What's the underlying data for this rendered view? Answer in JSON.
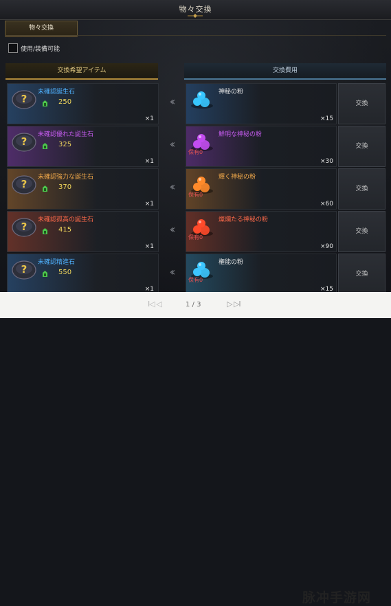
{
  "window": {
    "title": "物々交換"
  },
  "tab": {
    "label": "物々交換"
  },
  "filter": {
    "label": "使用/装備可能"
  },
  "headers": {
    "left": "交換希望アイテム",
    "right": "交換費用"
  },
  "colors": {
    "rarity_blue": "#4fb2ff",
    "rarity_purple": "#c65cf0",
    "rarity_orange": "#f0a84a",
    "rarity_red": "#ff6a4a",
    "value_yellow": "#f2d85c",
    "owned_red": "#e05252"
  },
  "rows": [
    {
      "item_name": "未確認誕生石",
      "item_color": "#4fb2ff",
      "item_value": "250",
      "item_qty": "×1",
      "mat_name": "神秘の粉",
      "mat_color": "#e6e6e6",
      "mat_kind": "blue",
      "owned": "",
      "mat_qty": "×15",
      "button": "交換"
    },
    {
      "item_name": "未確認優れた誕生石",
      "item_color": "#c65cf0",
      "item_value": "325",
      "item_qty": "×1",
      "mat_name": "鮮明な神秘の粉",
      "mat_color": "#c65cf0",
      "mat_kind": "purple",
      "owned": "保有0",
      "mat_qty": "×30",
      "button": "交換"
    },
    {
      "item_name": "未確認強力な誕生石",
      "item_color": "#f0a84a",
      "item_value": "370",
      "item_qty": "×1",
      "mat_name": "輝く神秘の粉",
      "mat_color": "#f0a84a",
      "mat_kind": "orange",
      "owned": "保有0",
      "mat_qty": "×60",
      "button": "交換"
    },
    {
      "item_name": "未確認孤高の誕生石",
      "item_color": "#ff6a4a",
      "item_value": "415",
      "item_qty": "×1",
      "mat_name": "燦爛たる神秘の粉",
      "mat_color": "#ff6a4a",
      "mat_kind": "red",
      "owned": "保有0",
      "mat_qty": "×90",
      "button": "交換"
    },
    {
      "item_name": "未確認精進石",
      "item_color": "#4fb2ff",
      "item_value": "550",
      "item_qty": "×1",
      "mat_name": "権能の粉",
      "mat_color": "#e6e6e6",
      "mat_kind": "cyan",
      "owned": "保有0",
      "mat_qty": "×15",
      "button": "交換"
    }
  ],
  "pager": {
    "prev": "I◁ ◁",
    "text": "1 / 3",
    "next": "▷ ▷I"
  },
  "watermark": "脉冲手游网"
}
